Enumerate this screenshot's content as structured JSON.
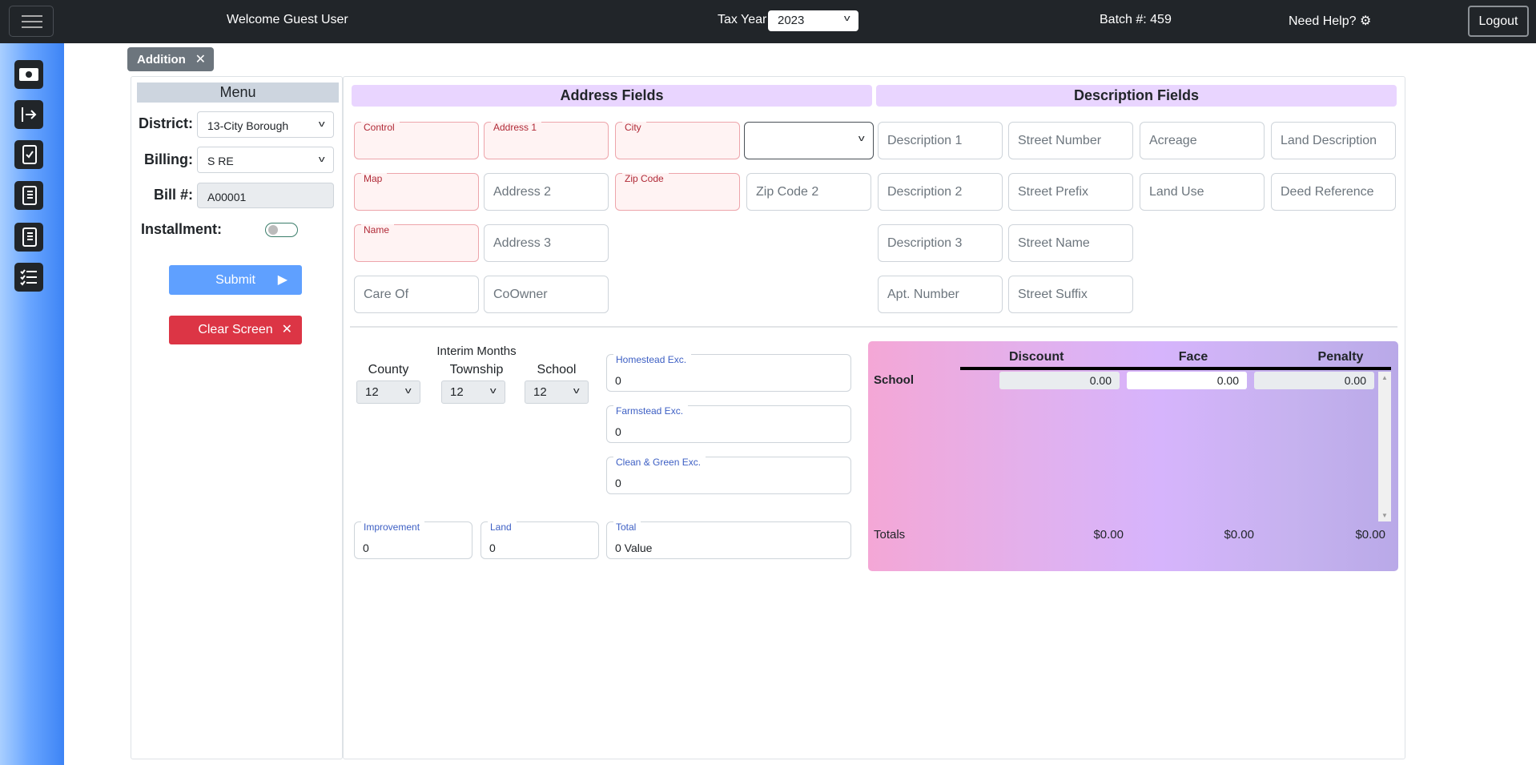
{
  "header": {
    "welcome": "Welcome Guest User",
    "tax_year_label": "Tax Year",
    "tax_year": "2023",
    "batch": "Batch #: 459",
    "help": "Need Help?",
    "logout": "Logout"
  },
  "sidebar": {
    "icons": [
      "cash-icon",
      "sign-in-icon",
      "checklist-icon",
      "journal-icon",
      "journal-list-icon",
      "task-list-icon"
    ]
  },
  "tab": {
    "label": "Addition"
  },
  "menu": {
    "title": "Menu",
    "district_label": "District:",
    "district": "13-City Borough",
    "billing_label": "Billing:",
    "billing": "S RE",
    "bill_label": "Bill #:",
    "bill": "A00001",
    "installment_label": "Installment:",
    "installment": false,
    "submit": "Submit",
    "clear": "Clear Screen"
  },
  "address": {
    "title": "Address Fields",
    "control": "Control",
    "address1": "Address 1",
    "city": "City",
    "state": "",
    "map": "Map",
    "address2": "Address 2",
    "zip": "Zip Code",
    "zip2": "Zip Code 2",
    "name": "Name",
    "address3": "Address 3",
    "care_of": "Care Of",
    "coowner": "CoOwner"
  },
  "description": {
    "title": "Description Fields",
    "fields": [
      "Description 1",
      "Street Number",
      "Acreage",
      "Land Description",
      "Description 2",
      "Street Prefix",
      "Land Use",
      "Deed Reference",
      "Description 3",
      "Street Name",
      "Apt. Number",
      "Street Suffix"
    ]
  },
  "interim": {
    "title": "Interim Months",
    "county_label": "County",
    "township_label": "Township",
    "school_label": "School",
    "county": "12",
    "township": "12",
    "school": "12"
  },
  "exemptions": {
    "homestead_label": "Homestead Exc.",
    "homestead": "0",
    "farmstead_label": "Farmstead Exc.",
    "farmstead": "0",
    "clean_green_label": "Clean & Green Exc.",
    "clean_green": "0"
  },
  "values": {
    "improvement_label": "Improvement",
    "improvement": "0",
    "land_label": "Land",
    "land": "0",
    "total_label": "Total",
    "total": "0 Value"
  },
  "taxes": {
    "discount": "Discount",
    "face": "Face",
    "penalty": "Penalty",
    "row_label": "School",
    "row_discount": "0.00",
    "row_face": "0.00",
    "row_penalty": "0.00",
    "totals_label": "Totals",
    "total_discount": "$0.00",
    "total_face": "$0.00",
    "total_penalty": "$0.00"
  },
  "colors": {
    "topbar": "#212529",
    "danger": "#dc3545",
    "primary": "#5fa0ff",
    "header_bg": "#e9d5ff"
  }
}
